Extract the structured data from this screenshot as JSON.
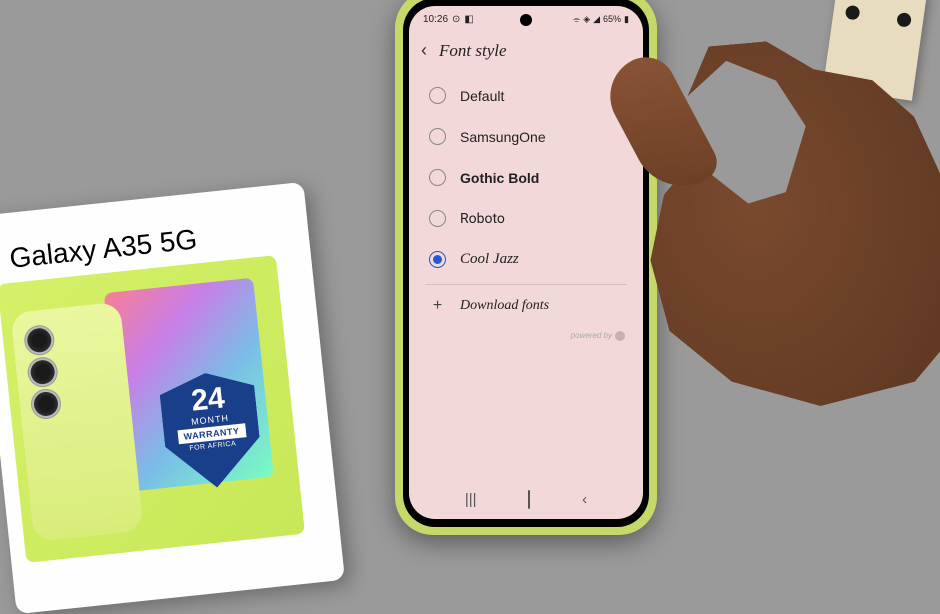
{
  "product_box": {
    "title": "Galaxy A35 5G",
    "badge": {
      "number": "24",
      "unit": "MONTH",
      "label": "WARRANTY",
      "region": "FOR AFRICA"
    }
  },
  "status_bar": {
    "time": "10:26",
    "battery": "65%"
  },
  "header": {
    "title": "Font style"
  },
  "options": [
    {
      "label": "Default",
      "selected": false,
      "font_class": "font-default"
    },
    {
      "label": "SamsungOne",
      "selected": false,
      "font_class": "font-samsung"
    },
    {
      "label": "Gothic Bold",
      "selected": false,
      "font_class": "font-gothic"
    },
    {
      "label": "Roboto",
      "selected": false,
      "font_class": "font-roboto"
    },
    {
      "label": "Cool Jazz",
      "selected": true,
      "font_class": "font-cooljazz"
    }
  ],
  "download": {
    "label": "Download fonts"
  },
  "footer": {
    "powered": "powered by"
  }
}
